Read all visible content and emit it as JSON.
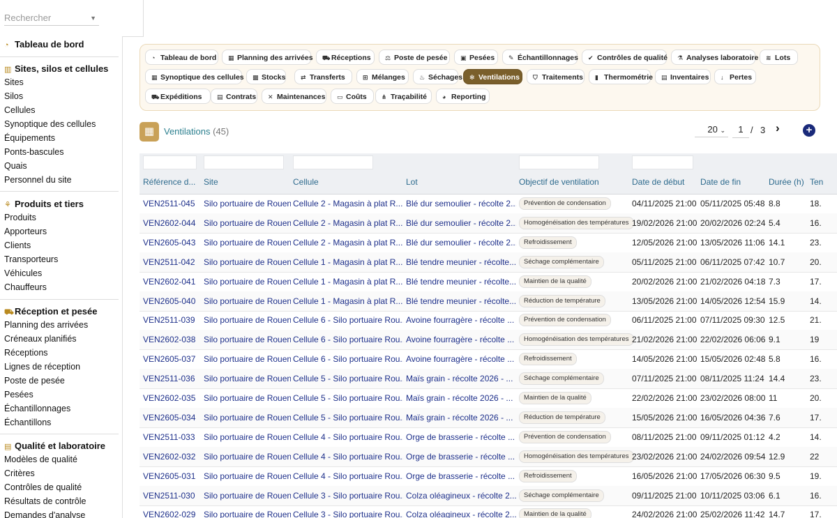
{
  "search": {
    "placeholder": "Rechercher"
  },
  "sidebar": {
    "sections": [
      {
        "title": "Tableau de bord",
        "icon": "dashboard-icon",
        "items": []
      },
      {
        "title": "Sites, silos et cellules",
        "icon": "warehouse-icon",
        "items": [
          "Sites",
          "Silos",
          "Cellules",
          "Synoptique des cellules",
          "Équipements",
          "Ponts-bascules",
          "Quais",
          "Personnel du site"
        ]
      },
      {
        "title": "Produits et tiers",
        "icon": "sprout-icon",
        "items": [
          "Produits",
          "Apporteurs",
          "Clients",
          "Transporteurs",
          "Véhicules",
          "Chauffeurs"
        ]
      },
      {
        "title": "Réception et pesée",
        "icon": "truck-icon",
        "items": [
          "Planning des arrivées",
          "Créneaux planifiés",
          "Réceptions",
          "Lignes de réception",
          "Poste de pesée",
          "Pesées",
          "Échantillonnages",
          "Échantillons"
        ]
      },
      {
        "title": "Qualité et laboratoire",
        "icon": "clipboard-icon",
        "items": [
          "Modèles de qualité",
          "Critères",
          "Contrôles de qualité",
          "Résultats de contrôle",
          "Demandes d'analyse"
        ]
      }
    ]
  },
  "nav": {
    "rows": [
      [
        {
          "label": "Tableau de bord",
          "icon": "dashboard-icon"
        },
        {
          "label": "Planning des arrivées",
          "icon": "calendar-icon"
        },
        {
          "label": "Réceptions",
          "icon": "truck-icon"
        },
        {
          "label": "Poste de pesée",
          "icon": "scale-icon"
        },
        {
          "label": "Pesées",
          "icon": "weight-icon"
        },
        {
          "label": "Échantillonnages",
          "icon": "pipette-icon"
        },
        {
          "label": "Contrôles de qualité",
          "icon": "check-circle-icon"
        },
        {
          "label": "Analyses laboratoire",
          "icon": "flask-icon"
        },
        {
          "label": "Lots",
          "icon": "layers-icon"
        }
      ],
      [
        {
          "label": "Synoptique des cellules",
          "icon": "grid-icon"
        },
        {
          "label": "Stocks",
          "icon": "boxes-icon"
        },
        {
          "label": "Transferts",
          "icon": "transfer-icon"
        },
        {
          "label": "Mélanges",
          "icon": "blend-icon"
        },
        {
          "label": "Séchages",
          "icon": "flame-icon"
        },
        {
          "label": "Ventilations",
          "icon": "fan-icon",
          "active": true
        },
        {
          "label": "Traitements",
          "icon": "shield-icon"
        },
        {
          "label": "Thermométrie",
          "icon": "thermometer-icon"
        },
        {
          "label": "Inventaires",
          "icon": "clipboard-icon"
        },
        {
          "label": "Pertes",
          "icon": "arrow-down-icon"
        }
      ],
      [
        {
          "label": "Expéditions",
          "icon": "truck-icon"
        },
        {
          "label": "Contrats",
          "icon": "document-icon"
        },
        {
          "label": "Maintenances",
          "icon": "wrench-icon"
        },
        {
          "label": "Coûts",
          "icon": "money-icon"
        },
        {
          "label": "Traçabilité",
          "icon": "tree-icon"
        },
        {
          "label": "Reporting",
          "icon": "chart-icon"
        }
      ]
    ]
  },
  "page": {
    "title": "Ventilations",
    "count": "(45)"
  },
  "pager": {
    "size": "20",
    "page": "1",
    "sep": "/",
    "total": "3"
  },
  "table": {
    "columns": [
      "Référence d...",
      "Site",
      "Cellule",
      "Lot",
      "Objectif de ventilation",
      "Date de début",
      "Date de fin",
      "Durée (h)",
      "Ten"
    ],
    "rows": [
      [
        "VEN2511-045",
        "Silo portuaire de Rouen",
        "Cellule 2 - Magasin à plat R...",
        "Blé dur semoulier - récolte 2...",
        "Prévention de condensation",
        "04/11/2025 21:00",
        "05/11/2025 05:48",
        "8.8",
        "18."
      ],
      [
        "VEN2602-044",
        "Silo portuaire de Rouen",
        "Cellule 2 - Magasin à plat R...",
        "Blé dur semoulier - récolte 2...",
        "Homogénéisation des températures",
        "19/02/2026 21:00",
        "20/02/2026 02:24",
        "5.4",
        "16."
      ],
      [
        "VEN2605-043",
        "Silo portuaire de Rouen",
        "Cellule 2 - Magasin à plat R...",
        "Blé dur semoulier - récolte 2...",
        "Refroidissement",
        "12/05/2026 21:00",
        "13/05/2026 11:06",
        "14.1",
        "23."
      ],
      [
        "VEN2511-042",
        "Silo portuaire de Rouen",
        "Cellule 1 - Magasin à plat R...",
        "Blé tendre meunier - récolte...",
        "Séchage complémentaire",
        "05/11/2025 21:00",
        "06/11/2025 07:42",
        "10.7",
        "20."
      ],
      [
        "VEN2602-041",
        "Silo portuaire de Rouen",
        "Cellule 1 - Magasin à plat R...",
        "Blé tendre meunier - récolte...",
        "Maintien de la qualité",
        "20/02/2026 21:00",
        "21/02/2026 04:18",
        "7.3",
        "17."
      ],
      [
        "VEN2605-040",
        "Silo portuaire de Rouen",
        "Cellule 1 - Magasin à plat R...",
        "Blé tendre meunier - récolte...",
        "Réduction de température",
        "13/05/2026 21:00",
        "14/05/2026 12:54",
        "15.9",
        "14."
      ],
      [
        "VEN2511-039",
        "Silo portuaire de Rouen",
        "Cellule 6 - Silo portuaire Rou...",
        "Avoine fourragère - récolte ...",
        "Prévention de condensation",
        "06/11/2025 21:00",
        "07/11/2025 09:30",
        "12.5",
        "21."
      ],
      [
        "VEN2602-038",
        "Silo portuaire de Rouen",
        "Cellule 6 - Silo portuaire Rou...",
        "Avoine fourragère - récolte ...",
        "Homogénéisation des températures",
        "21/02/2026 21:00",
        "22/02/2026 06:06",
        "9.1",
        "19"
      ],
      [
        "VEN2605-037",
        "Silo portuaire de Rouen",
        "Cellule 6 - Silo portuaire Rou...",
        "Avoine fourragère - récolte ...",
        "Refroidissement",
        "14/05/2026 21:00",
        "15/05/2026 02:48",
        "5.8",
        "16."
      ],
      [
        "VEN2511-036",
        "Silo portuaire de Rouen",
        "Cellule 5 - Silo portuaire Rou...",
        "Maïs grain - récolte 2026 - ...",
        "Séchage complémentaire",
        "07/11/2025 21:00",
        "08/11/2025 11:24",
        "14.4",
        "23."
      ],
      [
        "VEN2602-035",
        "Silo portuaire de Rouen",
        "Cellule 5 - Silo portuaire Rou...",
        "Maïs grain - récolte 2026 - ...",
        "Maintien de la qualité",
        "22/02/2026 21:00",
        "23/02/2026 08:00",
        "11",
        "20."
      ],
      [
        "VEN2605-034",
        "Silo portuaire de Rouen",
        "Cellule 5 - Silo portuaire Rou...",
        "Maïs grain - récolte 2026 - ...",
        "Réduction de température",
        "15/05/2026 21:00",
        "16/05/2026 04:36",
        "7.6",
        "17."
      ],
      [
        "VEN2511-033",
        "Silo portuaire de Rouen",
        "Cellule 4 - Silo portuaire Rou...",
        "Orge de brasserie - récolte ...",
        "Prévention de condensation",
        "08/11/2025 21:00",
        "09/11/2025 01:12",
        "4.2",
        "14."
      ],
      [
        "VEN2602-032",
        "Silo portuaire de Rouen",
        "Cellule 4 - Silo portuaire Rou...",
        "Orge de brasserie - récolte ...",
        "Homogénéisation des températures",
        "23/02/2026 21:00",
        "24/02/2026 09:54",
        "12.9",
        "22"
      ],
      [
        "VEN2605-031",
        "Silo portuaire de Rouen",
        "Cellule 4 - Silo portuaire Rou...",
        "Orge de brasserie - récolte ...",
        "Refroidissement",
        "16/05/2026 21:00",
        "17/05/2026 06:30",
        "9.5",
        "19."
      ],
      [
        "VEN2511-030",
        "Silo portuaire de Rouen",
        "Cellule 3 - Silo portuaire Rou...",
        "Colza oléagineux - récolte 2...",
        "Séchage complémentaire",
        "09/11/2025 21:00",
        "10/11/2025 03:06",
        "6.1",
        "16."
      ],
      [
        "VEN2602-029",
        "Silo portuaire de Rouen",
        "Cellule 3 - Silo portuaire Rou...",
        "Colza oléagineux - récolte 2...",
        "Maintien de la qualité",
        "24/02/2026 21:00",
        "25/02/2026 11:42",
        "14.7",
        "17."
      ]
    ]
  },
  "colors": {
    "accent": "#7a5f2b",
    "link": "#1d2f8a",
    "header_text": "#2d6a8d",
    "title": "#2b7f8e",
    "add_button": "#1a2a7a"
  }
}
